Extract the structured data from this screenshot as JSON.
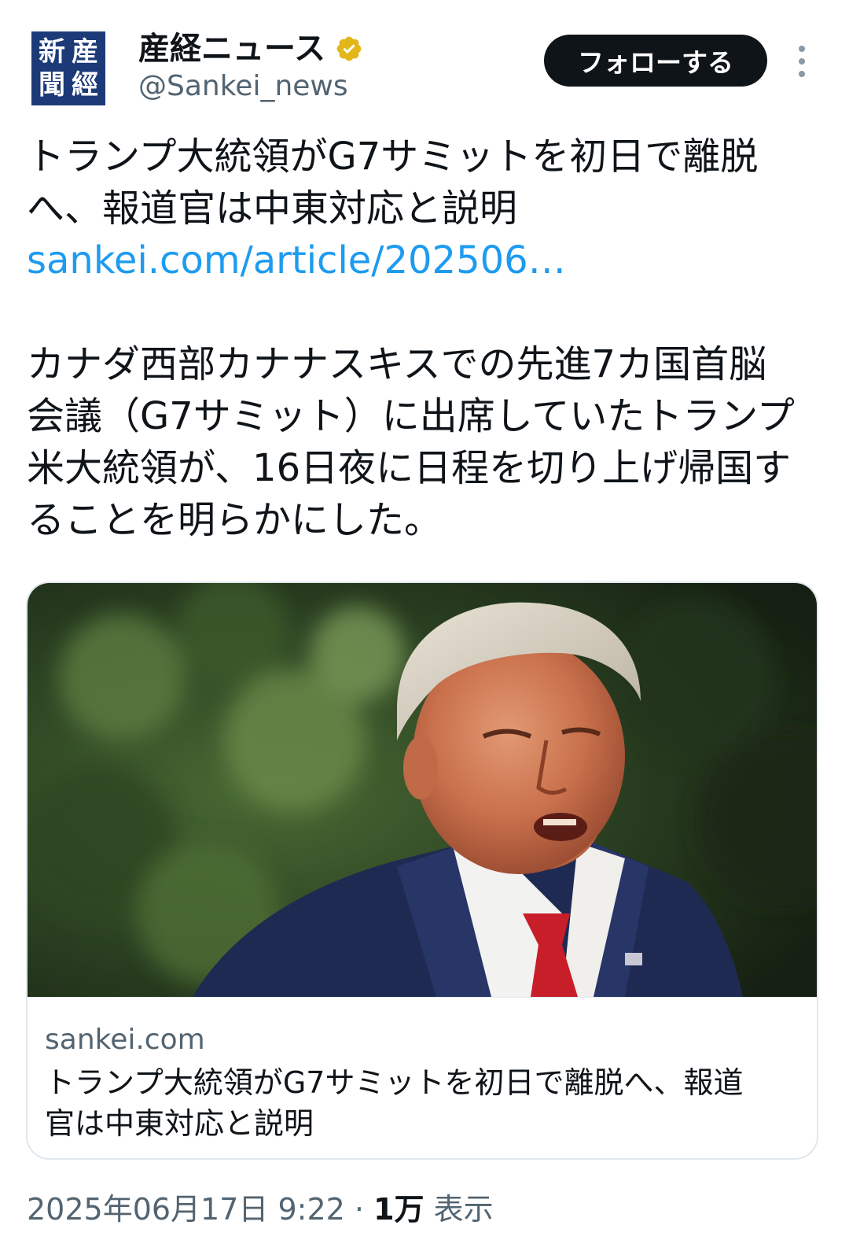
{
  "account": {
    "avatar_chars": [
      "産",
      "新",
      "經",
      "聞"
    ],
    "display_name": "産経ニュース",
    "handle": "@Sankei_news",
    "verified_badge_icon": "verified-gold-badge-icon",
    "follow_label": "フォローする",
    "more_icon": "more-vertical-icon"
  },
  "tweet": {
    "headline_line1": "トランプ大統領がG7サミットを初日で離脱",
    "headline_line2": "へ、報道官は中東対応と説明",
    "link_text": "sankei.com/article/202506…",
    "body_line1": "カナダ西部カナナスキスでの先進7カ国首脳",
    "body_line2": "会議（G7サミット）に出席していたトランプ",
    "body_line3": "米大統領が、16日夜に日程を切り上げ帰国す",
    "body_line4": "ることを明らかにした。"
  },
  "card": {
    "domain": "sankei.com",
    "title_line1": "トランプ大統領がG7サミットを初日で離脱へ、報道",
    "title_line2": "官は中東対応と説明"
  },
  "meta": {
    "timestamp": "2025年06月17日 9:22",
    "separator": "·",
    "views_count": "1万",
    "views_label": "表示"
  },
  "colors": {
    "text_primary": "#0f1419",
    "text_secondary": "#536471",
    "link": "#1d9bf0",
    "verified_gold": "#e2b719",
    "avatar_bg": "#1d3a78",
    "button_bg": "#0f1419"
  }
}
